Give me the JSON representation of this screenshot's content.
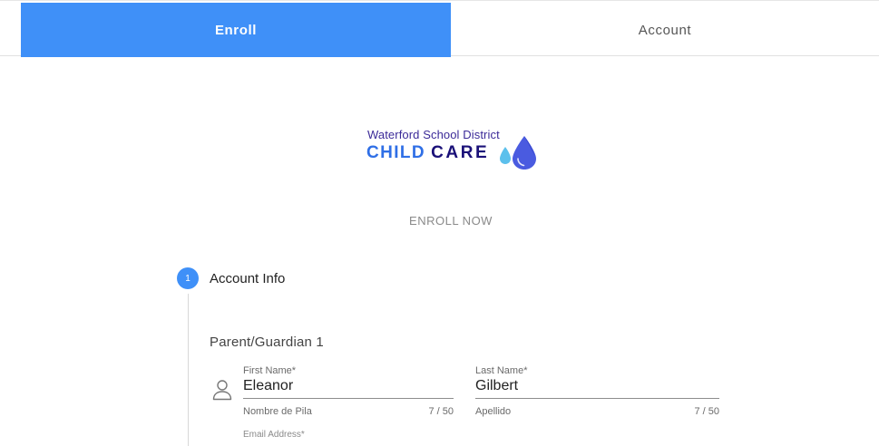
{
  "tabs": [
    {
      "label": "Enroll",
      "active": true
    },
    {
      "label": "Account",
      "active": false
    }
  ],
  "logo": {
    "line1": "Waterford School District",
    "word1": "CHILD",
    "word2": "CARE"
  },
  "enroll_heading": "ENROLL NOW",
  "stepper": {
    "step_number": "1",
    "step_label": "Account Info"
  },
  "guardian": {
    "title": "Parent/Guardian 1",
    "first_name": {
      "label": "First Name*",
      "value": "Eleanor",
      "hint": "Nombre de Pila",
      "counter": "7 / 50"
    },
    "last_name": {
      "label": "Last Name*",
      "value": "Gilbert",
      "hint": "Apellido",
      "counter": "7 / 50"
    },
    "email_label": "Email Address*"
  },
  "colors": {
    "accent": "#3f90f8",
    "logo_blue": "#2f6fe6",
    "logo_navy": "#1a1078"
  },
  "icons": [
    "person-icon",
    "water-drop-icon"
  ]
}
